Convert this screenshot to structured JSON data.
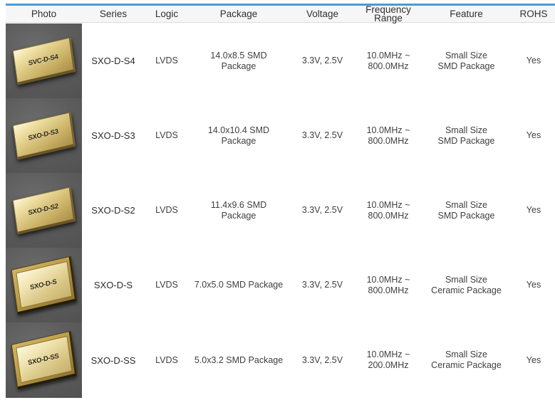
{
  "theme": {
    "accent_color": "#4a9bd4",
    "header_bg": "#f6f6f6",
    "photo_bg": "#5d5d5d",
    "text_color": "#3f3f3f"
  },
  "table": {
    "columns": [
      {
        "key": "photo",
        "label": "Photo"
      },
      {
        "key": "series",
        "label": "Series"
      },
      {
        "key": "logic",
        "label": "Logic"
      },
      {
        "key": "package",
        "label": "Package"
      },
      {
        "key": "voltage",
        "label": "Voltage"
      },
      {
        "key": "frequency_range",
        "label": "Frequency\nRange"
      },
      {
        "key": "feature",
        "label": "Feature"
      },
      {
        "key": "rohs",
        "label": "ROHS"
      }
    ],
    "rows": [
      {
        "photo_label": "SVC-D-S4",
        "photo_style": "gold",
        "series": "SXO-D-S4",
        "logic": "LVDS",
        "package": "14.0x8.5 SMD\nPackage",
        "voltage": "3.3V, 2.5V",
        "frequency_range": "10.0MHz ~\n800.0MHz",
        "feature": "Small Size\nSMD Package",
        "rohs": "Yes"
      },
      {
        "photo_label": "SXO-D-S3",
        "photo_style": "gold",
        "series": "SXO-D-S3",
        "logic": "LVDS",
        "package": "14.0x10.4 SMD\nPackage",
        "voltage": "3.3V, 2.5V",
        "frequency_range": "10.0MHz ~\n800.0MHz",
        "feature": "Small Size\nSMD Package",
        "rohs": "Yes"
      },
      {
        "photo_label": "SXO-D-S2",
        "photo_style": "gold",
        "series": "SXO-D-S2",
        "logic": "LVDS",
        "package": "11.4x9.6 SMD\nPackage",
        "voltage": "3.3V, 2.5V",
        "frequency_range": "10.0MHz ~\n800.0MHz",
        "feature": "Small Size\nSMD Package",
        "rohs": "Yes"
      },
      {
        "photo_label": "SXO-D-S",
        "photo_style": "ceramic",
        "series": "SXO-D-S",
        "logic": "LVDS",
        "package": "7.0x5.0 SMD Package",
        "voltage": "3.3V, 2.5V",
        "frequency_range": "10.0MHz ~\n800.0MHz",
        "feature": "Small Size\nCeramic Package",
        "rohs": "Yes"
      },
      {
        "photo_label": "SXO-D-SS",
        "photo_style": "ceramic",
        "series": "SXO-D-SS",
        "logic": "LVDS",
        "package": "5.0x3.2 SMD Package",
        "voltage": "3.3V, 2.5V",
        "frequency_range": "10.0MHz ~\n200.0MHz",
        "feature": "Small Size\nCeramic Package",
        "rohs": "Yes"
      }
    ]
  }
}
